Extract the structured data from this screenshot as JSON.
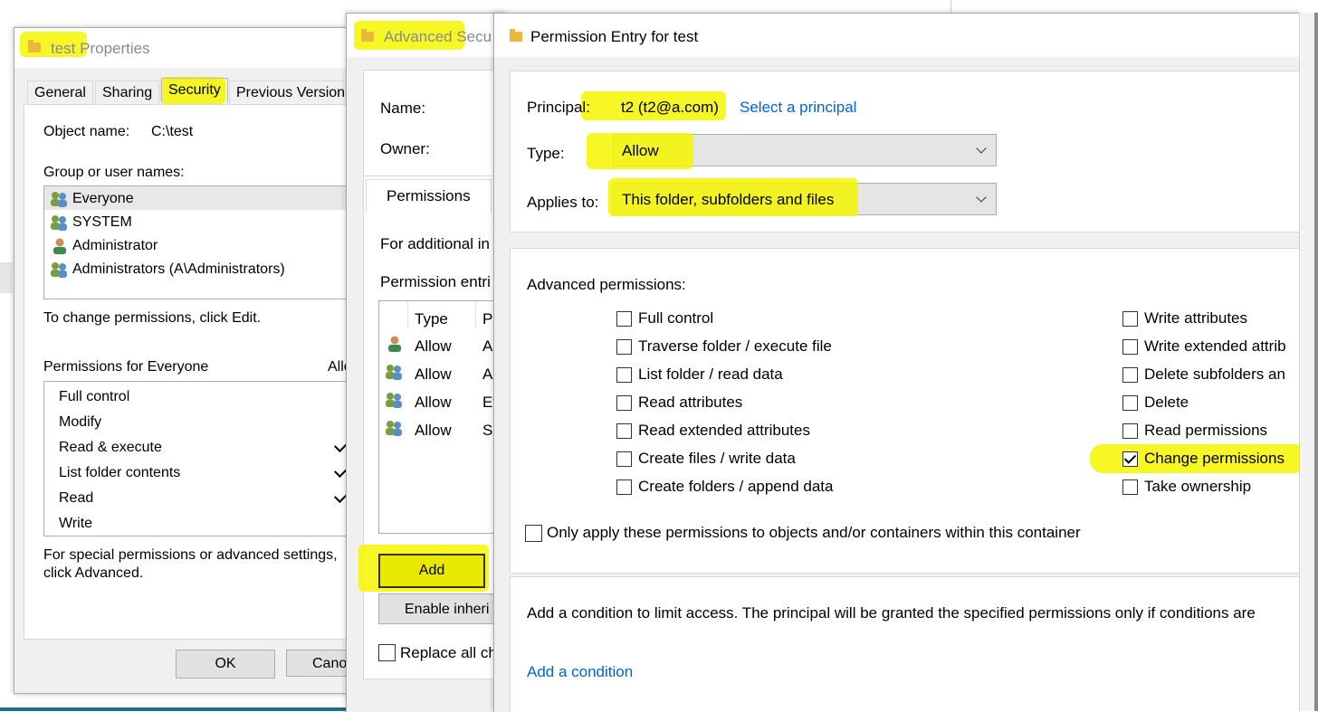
{
  "props": {
    "title_pre": "test",
    "title_post": " Properties",
    "tabs": [
      "General",
      "Sharing",
      "Security",
      "Previous Versions"
    ],
    "object_name_label": "Object name:",
    "object_name_value": "C:\\test",
    "group_label": "Group or user names:",
    "users": [
      "Everyone",
      "SYSTEM",
      "Administrator",
      "Administrators (A\\Administrators)"
    ],
    "change_hint": "To change permissions, click Edit.",
    "perms_for": "Permissions for Everyone",
    "allow_col": "Allo",
    "perm_items": [
      "Full control",
      "Modify",
      "Read & execute",
      "List folder contents",
      "Read",
      "Write"
    ],
    "special_hint_1": "For special permissions or advanced settings,",
    "special_hint_2": "click Advanced.",
    "ok": "OK",
    "cancel": "Cano"
  },
  "adv": {
    "title_a": "Advanced Secu",
    "name_label": "Name:",
    "owner_label": "Owner:",
    "tab_permissions": "Permissions",
    "for_additional": "For additional in",
    "perm_entries": "Permission entri",
    "col_type": "Type",
    "col_pr": "Pr",
    "rows": [
      {
        "type": "Allow",
        "pr": "A"
      },
      {
        "type": "Allow",
        "pr": "A"
      },
      {
        "type": "Allow",
        "pr": "Ev"
      },
      {
        "type": "Allow",
        "pr": "SY"
      }
    ],
    "add": "Add",
    "enable_inherit": "Enable inheri",
    "replace_all": "Replace all ch"
  },
  "entry": {
    "title": "Permission Entry for test",
    "principal_label": "Principal:",
    "principal_value": "t2 (t2@a.com)",
    "select_principal": "Select a principal",
    "type_label": "Type:",
    "type_value": "Allow",
    "applies_label": "Applies to:",
    "applies_value": "This folder, subfolders and files",
    "adv_perms_label": "Advanced permissions:",
    "left_perms": [
      {
        "label": "Full control",
        "checked": false
      },
      {
        "label": "Traverse folder / execute file",
        "checked": false
      },
      {
        "label": "List folder / read data",
        "checked": false
      },
      {
        "label": "Read attributes",
        "checked": false
      },
      {
        "label": "Read extended attributes",
        "checked": false
      },
      {
        "label": "Create files / write data",
        "checked": false
      },
      {
        "label": "Create folders / append data",
        "checked": false
      }
    ],
    "right_perms": [
      {
        "label": "Write attributes",
        "checked": false
      },
      {
        "label": "Write extended attrib",
        "checked": false
      },
      {
        "label": "Delete subfolders an",
        "checked": false
      },
      {
        "label": "Delete",
        "checked": false
      },
      {
        "label": "Read permissions",
        "checked": false
      },
      {
        "label": "Change permissions",
        "checked": true
      },
      {
        "label": "Take ownership",
        "checked": false
      }
    ],
    "only_apply": "Only apply these permissions to objects and/or containers within this container",
    "condition_text": "Add a condition to limit access. The principal will be granted the specified permissions only if conditions are",
    "add_condition": "Add a condition"
  },
  "colors": {
    "highlight": "#f6f600",
    "link": "#0066cc",
    "folder": "#e8b93a"
  }
}
